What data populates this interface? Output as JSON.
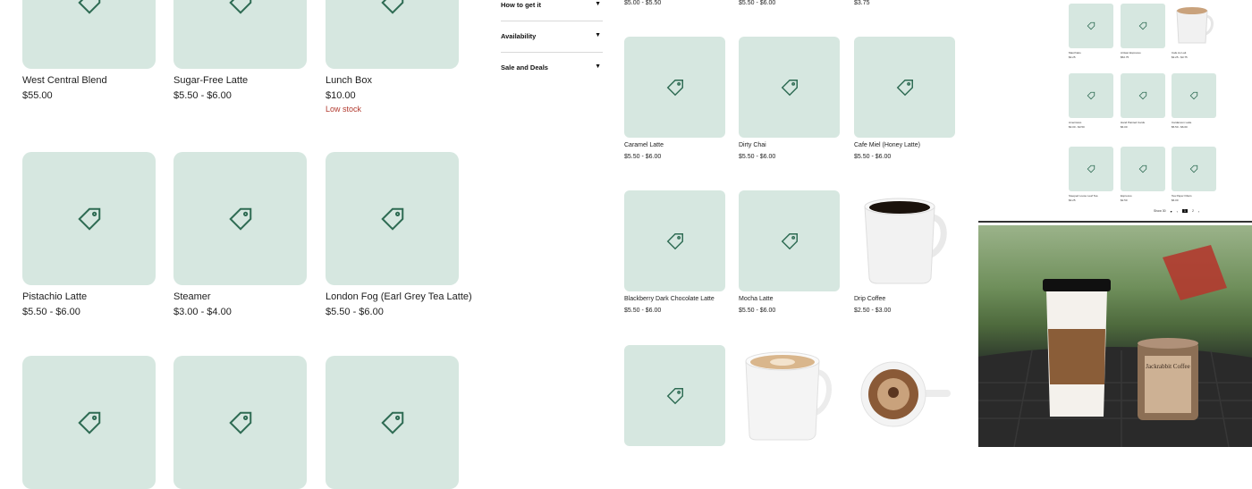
{
  "left_products": [
    {
      "name": "West Central Blend",
      "price": "$55.00",
      "stock": ""
    },
    {
      "name": "Sugar-Free Latte",
      "price": "$5.50 - $6.00",
      "stock": ""
    },
    {
      "name": "Lunch Box",
      "price": "$10.00",
      "stock": "Low stock"
    },
    {
      "name": "Pistachio Latte",
      "price": "$5.50 - $6.00",
      "stock": ""
    },
    {
      "name": "Steamer",
      "price": "$3.00 - $4.00",
      "stock": ""
    },
    {
      "name": "London Fog (Earl Grey Tea Latte)",
      "price": "$5.50 - $6.00",
      "stock": ""
    }
  ],
  "filters": {
    "items": [
      {
        "label": "How to get it"
      },
      {
        "label": "Availability"
      },
      {
        "label": "Sale and Deals"
      }
    ],
    "arrow_glyph": "▼"
  },
  "middle_top_prices": [
    "$5.00 - $5.50",
    "$5.50 - $6.00",
    "$3.75"
  ],
  "middle_products": [
    {
      "name": "Caramel Latte",
      "price": "$5.50 - $6.00"
    },
    {
      "name": "Dirty Chai",
      "price": "$5.50 - $6.00"
    },
    {
      "name": "Cafe Miel (Honey Latte)",
      "price": "$5.50 - $6.00"
    },
    {
      "name": "Blackberry Dark Chocolate Latte",
      "price": "$5.50 - $6.00"
    },
    {
      "name": "Mocha Latte",
      "price": "$5.50 - $6.00"
    },
    {
      "name": "Drip Coffee",
      "price": "$2.50 - $3.00"
    }
  ],
  "thumb_grid": {
    "items": [
      {
        "name": "Macchiato",
        "price": "$3.25"
      },
      {
        "name": "Artisan Espresso",
        "price": "$52.75"
      },
      {
        "name": "Cafe Au Lait",
        "price": "$3.25 - $3.75"
      },
      {
        "name": "Americano",
        "price": "$3.00 - $3.50"
      },
      {
        "name": "Hand Painted Cards",
        "price": "$6.00"
      },
      {
        "name": "Cardamom Latte",
        "price": "$5.50 - $6.00"
      },
      {
        "name": "Steeped Loose Leaf Tea",
        "price": "$3.25"
      },
      {
        "name": "Espresso",
        "price": "$2.50"
      },
      {
        "name": "Tea Paper Filters",
        "price": "$6.00"
      }
    ],
    "pagination": {
      "show_label": "Show 30",
      "current_page": "1",
      "next_page": "2"
    }
  },
  "photo": {
    "tin_label": "Jackrabbit Coffee"
  },
  "colors": {
    "tile_bg": "#d6e7e0",
    "tag_icon": "#2e6b53",
    "low_stock": "#b23a2f"
  }
}
